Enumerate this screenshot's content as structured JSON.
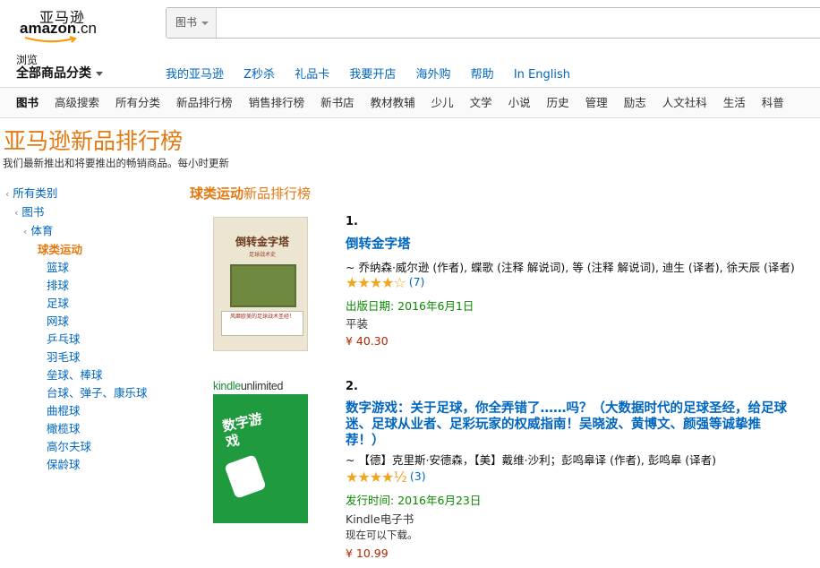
{
  "logo": {
    "zh": "亚马逊",
    "en": "amazon",
    "cn": ".cn"
  },
  "search": {
    "category": "图书",
    "placeholder": ""
  },
  "browse": {
    "small": "浏览",
    "big": "全部商品分类"
  },
  "topnav": [
    "我的亚马逊",
    "Z秒杀",
    "礼品卡",
    "我要开店",
    "海外购",
    "帮助",
    "In English"
  ],
  "subnav": [
    "图书",
    "高级搜索",
    "所有分类",
    "新品排行榜",
    "销售排行榜",
    "新书店",
    "教材教辅",
    "少儿",
    "文学",
    "小说",
    "历史",
    "管理",
    "励志",
    "人文社科",
    "生活",
    "科普"
  ],
  "page": {
    "title": "亚马逊新品排行榜",
    "subtitle": "我们最新推出和将要推出的畅销商品。每小时更新"
  },
  "leftnav": {
    "all": "所有类别",
    "books": "图书",
    "sports": "体育",
    "current": "球类运动",
    "children": [
      "篮球",
      "排球",
      "足球",
      "网球",
      "乒乓球",
      "羽毛球",
      "垒球、棒球",
      "台球、弹子、康乐球",
      "曲棍球",
      "橄榄球",
      "高尔夫球",
      "保龄球"
    ]
  },
  "section": {
    "bold": "球类运动",
    "rest": "新品排行榜"
  },
  "items": [
    {
      "rank": "1.",
      "title": "倒转金字塔",
      "authors": "~ 乔纳森·威尔逊 (作者), 蝶歌 (注释 解说词), 等 (注释 解说词), 迪生 (译者), 徐天辰 (译者)",
      "stars": "★★★★☆",
      "rating": 4,
      "reviews": "(7)",
      "date": "出版日期: 2016年6月1日",
      "format": "平装",
      "price": "¥ 40.30",
      "cover": {
        "title": "倒转金字塔",
        "subtitle": "足球战术史",
        "band": "风靡欧美的足球战术圣经！"
      }
    },
    {
      "rank": "2.",
      "title": "数字游戏：关于足球，你全弄错了……吗？（大数据时代的足球圣经，给足球迷、足球从业者、足彩玩家的权威指南！吴晓波、黄博文、颜强等诚挚推荐！）",
      "authors": "~ 【德】克里斯·安德森，【美】戴维·沙利；彭鸣皋译 (作者), 彭鸣皋 (译者)",
      "stars": "★★★★½",
      "rating": 4.5,
      "reviews": "(3)",
      "date": "发行时间: 2016年6月23日",
      "format": "Kindle电子书",
      "availability": "现在可以下载。",
      "price": "¥ 10.99",
      "cover": {
        "ku": "kindle",
        "ku2": "unlimited",
        "title": "数字游戏"
      }
    }
  ],
  "colors": {
    "link": "#0066c0",
    "accent": "#e47911",
    "price": "#b12704",
    "date": "#0b8a00",
    "star": "#f0a61f"
  }
}
